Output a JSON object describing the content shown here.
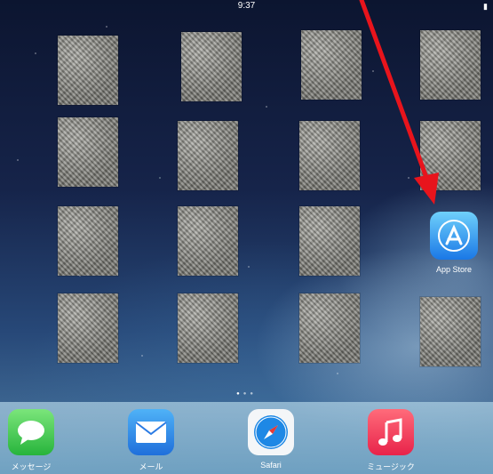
{
  "status_bar": {
    "time": "9:37",
    "right": ""
  },
  "home_grid": {
    "redacted_icons": [
      {
        "row": 1,
        "col": 1
      },
      {
        "row": 1,
        "col": 2
      },
      {
        "row": 1,
        "col": 3
      },
      {
        "row": 1,
        "col": 4
      },
      {
        "row": 2,
        "col": 1
      },
      {
        "row": 2,
        "col": 2
      },
      {
        "row": 2,
        "col": 3
      },
      {
        "row": 2,
        "col": 4
      },
      {
        "row": 3,
        "col": 1
      },
      {
        "row": 3,
        "col": 2
      },
      {
        "row": 3,
        "col": 3
      },
      {
        "row": 4,
        "col": 1
      },
      {
        "row": 4,
        "col": 2
      },
      {
        "row": 4,
        "col": 3
      },
      {
        "row": 4,
        "col": 4
      }
    ],
    "app_store": {
      "label": "App Store",
      "icon": "app-store-icon",
      "color": "#1a78e6"
    }
  },
  "page_indicator": {
    "pages": 3,
    "current": 1
  },
  "dock": {
    "apps": [
      {
        "label": "メッセージ",
        "icon": "messages-icon",
        "color": "#4cd964"
      },
      {
        "label": "メール",
        "icon": "mail-icon",
        "color": "#2a7be4"
      },
      {
        "label": "Safari",
        "icon": "safari-icon",
        "color": "#1e88e5"
      },
      {
        "label": "ミュージック",
        "icon": "music-icon",
        "color": "#f0364f"
      }
    ]
  },
  "annotation": {
    "type": "arrow",
    "color": "#e8141c",
    "target": "App Store"
  }
}
